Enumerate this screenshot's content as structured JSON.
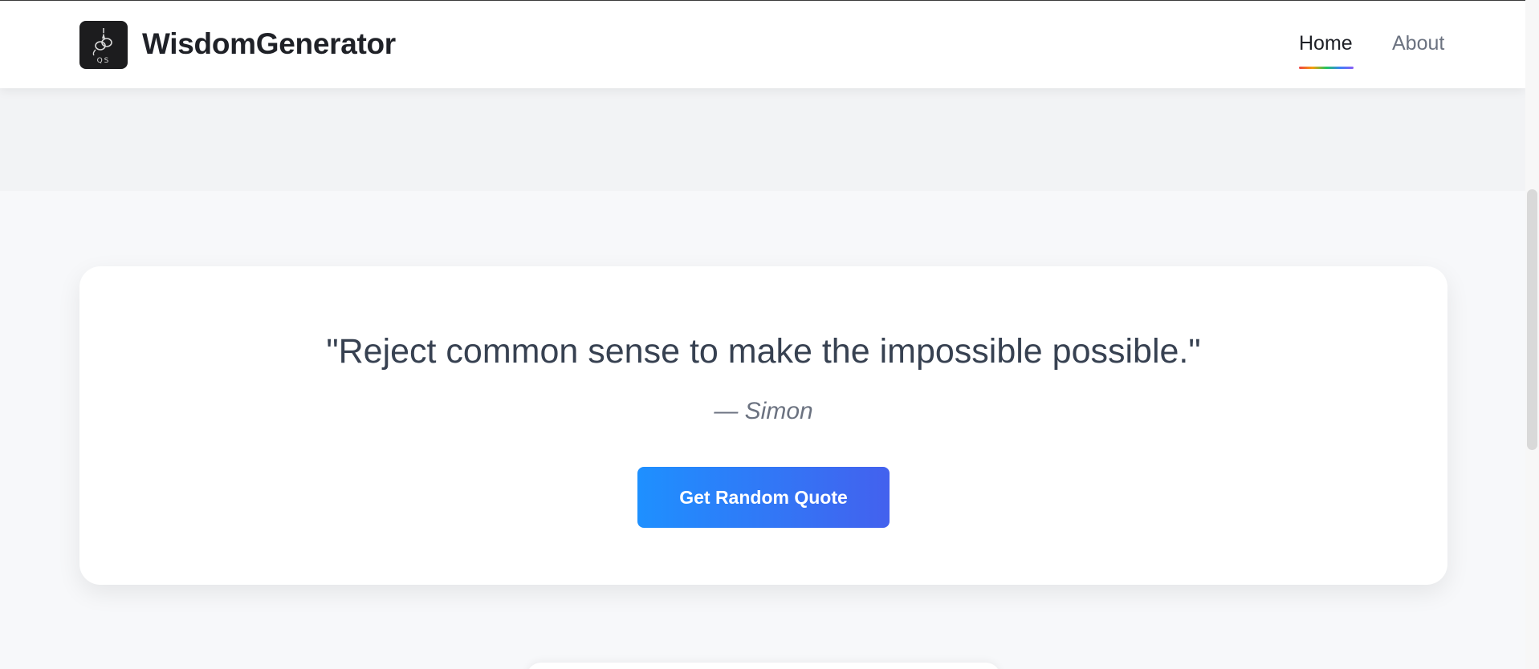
{
  "header": {
    "logo_text": "QS",
    "brand": "WisdomGenerator",
    "nav": [
      {
        "label": "Home",
        "active": true
      },
      {
        "label": "About",
        "active": false
      }
    ]
  },
  "quote_card": {
    "quote": "\"Reject common sense to make the impossible possible.\"",
    "author": "— Simon",
    "button_label": "Get Random Quote"
  },
  "icons": {
    "logo": "quote-swirl-logo-icon"
  },
  "colors": {
    "button_gradient_start": "#1e90ff",
    "button_gradient_end": "#4361ee",
    "brand_text": "#1f2127",
    "nav_inactive": "#6b7280",
    "quote_text": "#374151"
  }
}
